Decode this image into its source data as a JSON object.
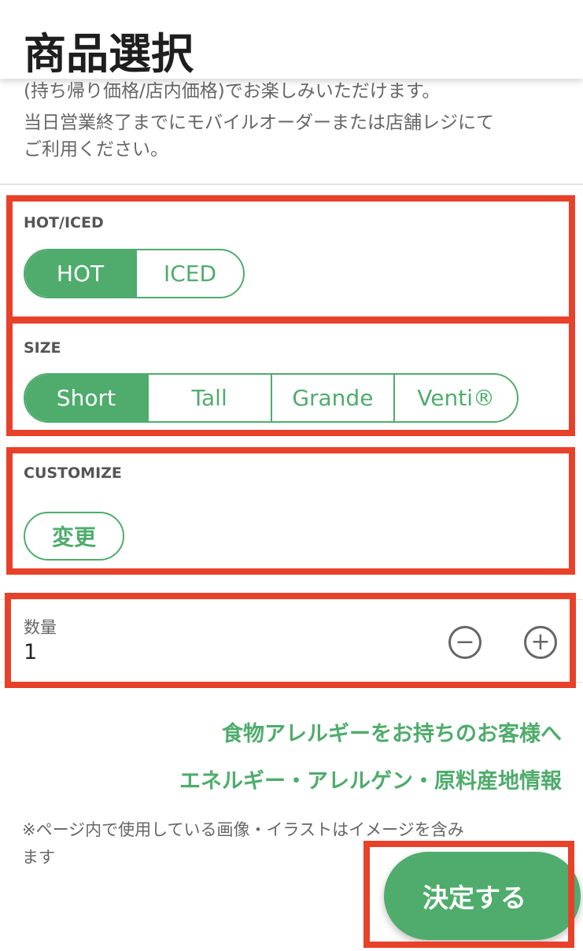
{
  "header": {
    "title": "商品選択"
  },
  "description": [
    "(持ち帰り価格/店内価格)でお楽しみいただけます。",
    "当日営業終了までにモバイルオーダーまたは店舗レジにて",
    "ご利用ください。"
  ],
  "hot_iced": {
    "label": "HOT/ICED",
    "options": [
      "HOT",
      "ICED"
    ],
    "selected": "HOT"
  },
  "size": {
    "label": "SIZE",
    "options": [
      "Short",
      "Tall",
      "Grande",
      "Venti®"
    ],
    "selected": "Short"
  },
  "customize": {
    "label": "CUSTOMIZE",
    "button": "変更"
  },
  "quantity": {
    "label": "数量",
    "value": "1",
    "minus_icon": "minus-circle-icon",
    "plus_icon": "plus-circle-icon"
  },
  "links": {
    "allergy": "食物アレルギーをお持ちのお客様へ",
    "info": "エネルギー・アレルゲン・原料産地情報"
  },
  "note": [
    "※ページ内で使用している画像・イラストはイメージを含み",
    "ます"
  ],
  "confirm_button": "決定する",
  "colors": {
    "accent": "#4fac6c",
    "annotation": "#e8412a"
  }
}
